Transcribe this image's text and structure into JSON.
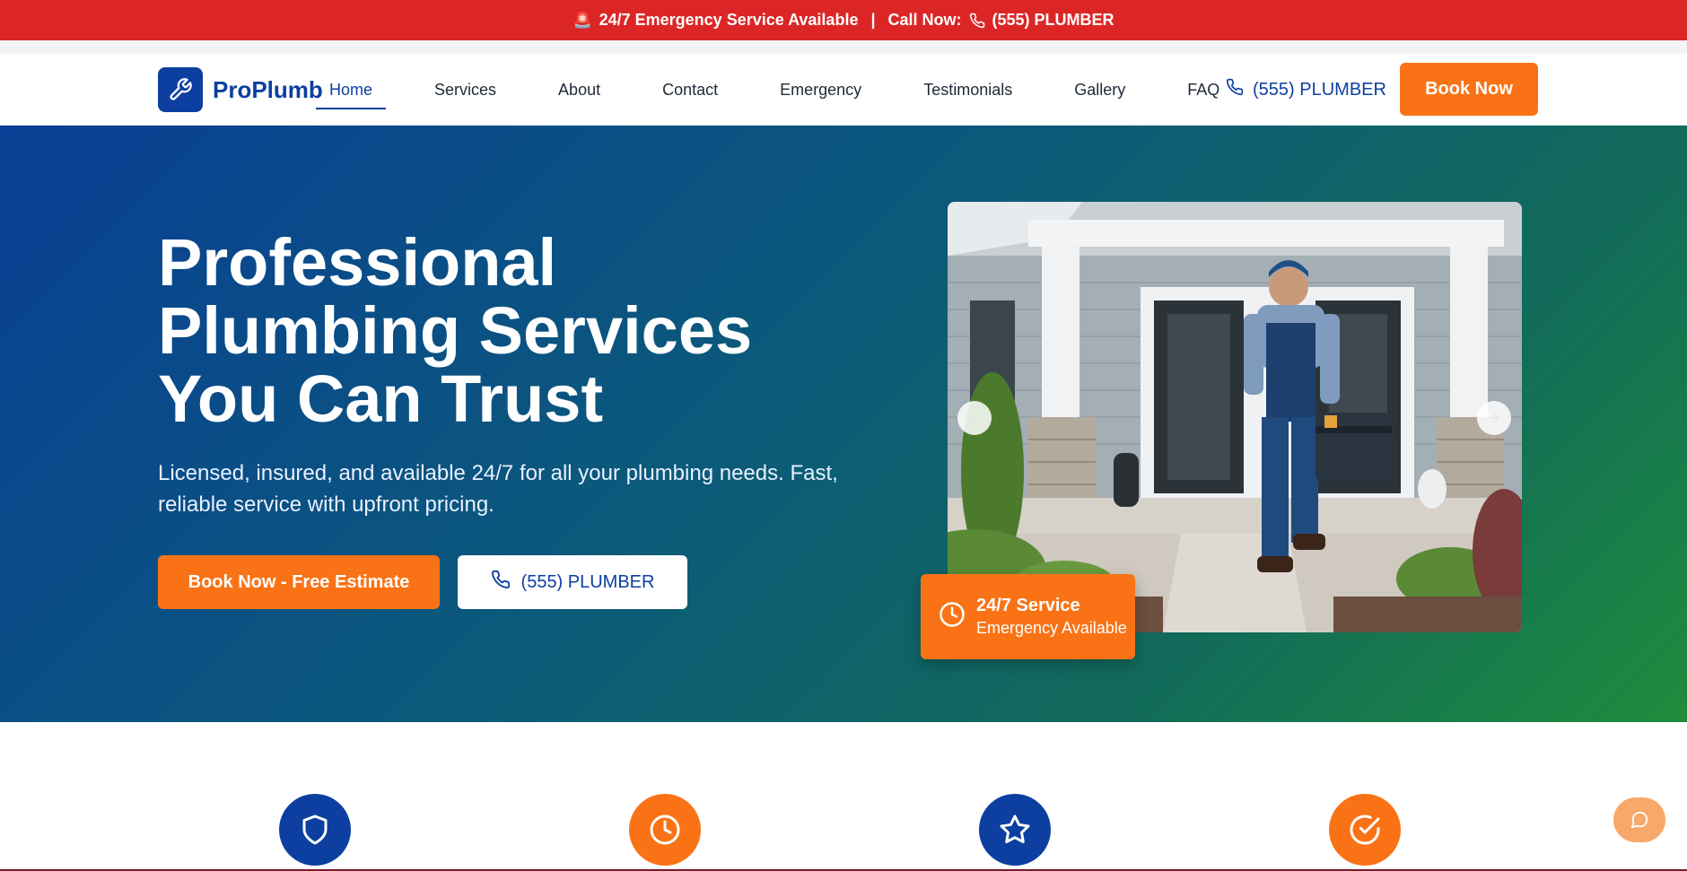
{
  "topbar": {
    "siren_icon": "siren-icon",
    "emergency_text": "24/7 Emergency Service Available",
    "separator": "|",
    "call_label": "Call Now:",
    "phone": "(555) PLUMBER"
  },
  "nav": {
    "logo_text": "ProPlumb",
    "logo_icon": "wrench-icon",
    "links": [
      "Home",
      "Services",
      "About",
      "Contact",
      "Emergency",
      "Testimonials",
      "Gallery",
      "FAQ"
    ],
    "active_link": "Home",
    "phone": "(555) PLUMBER",
    "book_label": "Book Now"
  },
  "hero": {
    "title": "Professional Plumbing Services You Can Trust",
    "subtitle": "Licensed, insured, and available 24/7 for all your plumbing needs. Fast, reliable service with upfront pricing.",
    "primary_button": "Book Now - Free Estimate",
    "secondary_button": "(555) PLUMBER",
    "carousel": {
      "prev_icon": "arrow-left-icon",
      "next_icon": "arrow-right-icon",
      "image_subject": "plumber carrying toolbox at house entrance"
    },
    "badge": {
      "title": "24/7 Service",
      "subtitle": "Emergency Available",
      "icon": "clock-icon"
    }
  },
  "features": {
    "icons": [
      "shield-icon",
      "clock-icon",
      "star-icon",
      "check-circle-icon"
    ]
  },
  "colors": {
    "brand_blue": "#0c3fa0",
    "accent_orange": "#f97316",
    "emergency_red": "#dc2626"
  }
}
